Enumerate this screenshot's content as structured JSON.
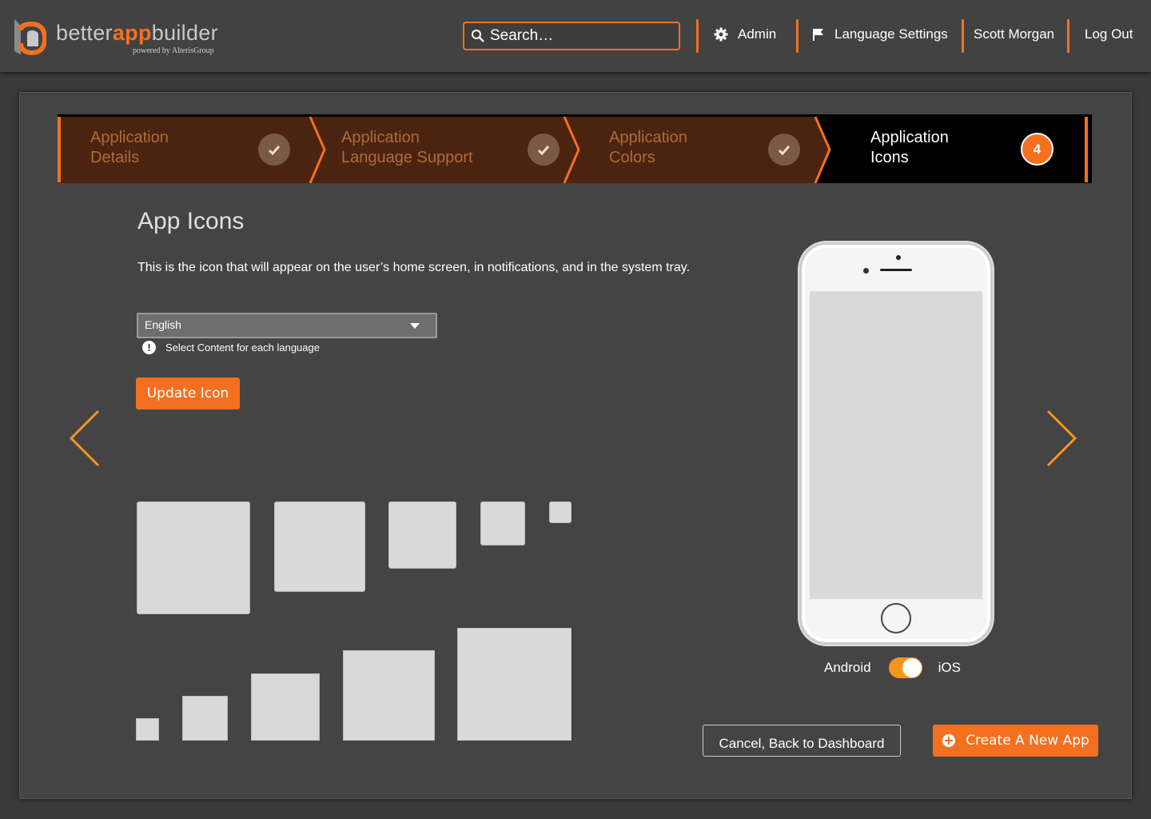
{
  "brand": {
    "name_part1": "better",
    "name_part2": "app",
    "name_part3": "builder",
    "tagline": "powered by AlterisGroup",
    "accent_color": "#f37021"
  },
  "header": {
    "search_placeholder": "Search…",
    "admin_label": "Admin",
    "language_settings_label": "Language Settings",
    "user_name": "Scott Morgan",
    "logout_label": "Log Out"
  },
  "stepper": {
    "steps": [
      {
        "line1": "Application",
        "line2": "Details",
        "status": "complete"
      },
      {
        "line1": "Application",
        "line2": "Language Support",
        "status": "complete"
      },
      {
        "line1": "Application",
        "line2": "Colors",
        "status": "complete"
      },
      {
        "line1": "Application",
        "line2": "Icons",
        "status": "current",
        "number": "4"
      }
    ]
  },
  "content": {
    "title": "App Icons",
    "description": "This is the icon that will appear on the user’s home screen, in notifications, and in the system tray.",
    "language_select_value": "English",
    "language_hint": "Select Content for each language",
    "update_icon_label": "Update Icon"
  },
  "preview": {
    "toggle_left_label": "Android",
    "toggle_right_label": "iOS",
    "toggle_state": "iOS"
  },
  "footer": {
    "cancel_label": "Cancel, Back to Dashboard",
    "create_label": "Create A New App"
  }
}
